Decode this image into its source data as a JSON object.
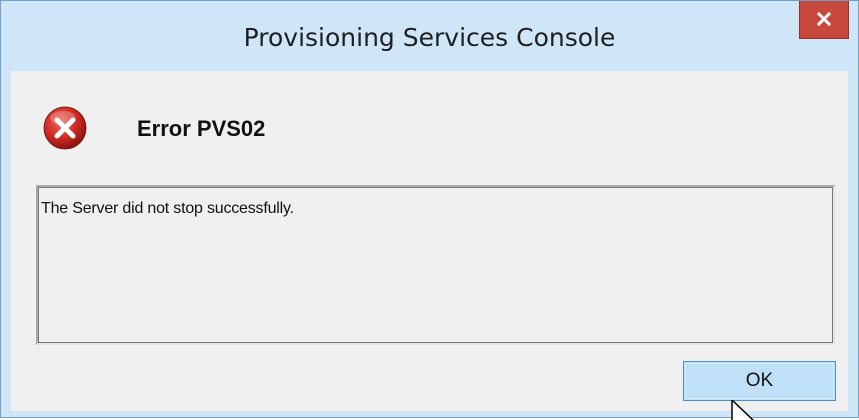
{
  "window": {
    "title": "Provisioning Services Console",
    "close_glyph": "x"
  },
  "dialog": {
    "icon": "error-icon",
    "heading": "Error PVS02",
    "message": "The Server did not stop successfully.",
    "ok_label": "OK"
  },
  "colors": {
    "title_bar": "#cfe6f8",
    "close_button": "#c7493d",
    "client_bg": "#f0f0f0",
    "ok_button": "#bfe0f7",
    "error_red": "#c9241f"
  },
  "cursor": "arrow-pointer-icon"
}
